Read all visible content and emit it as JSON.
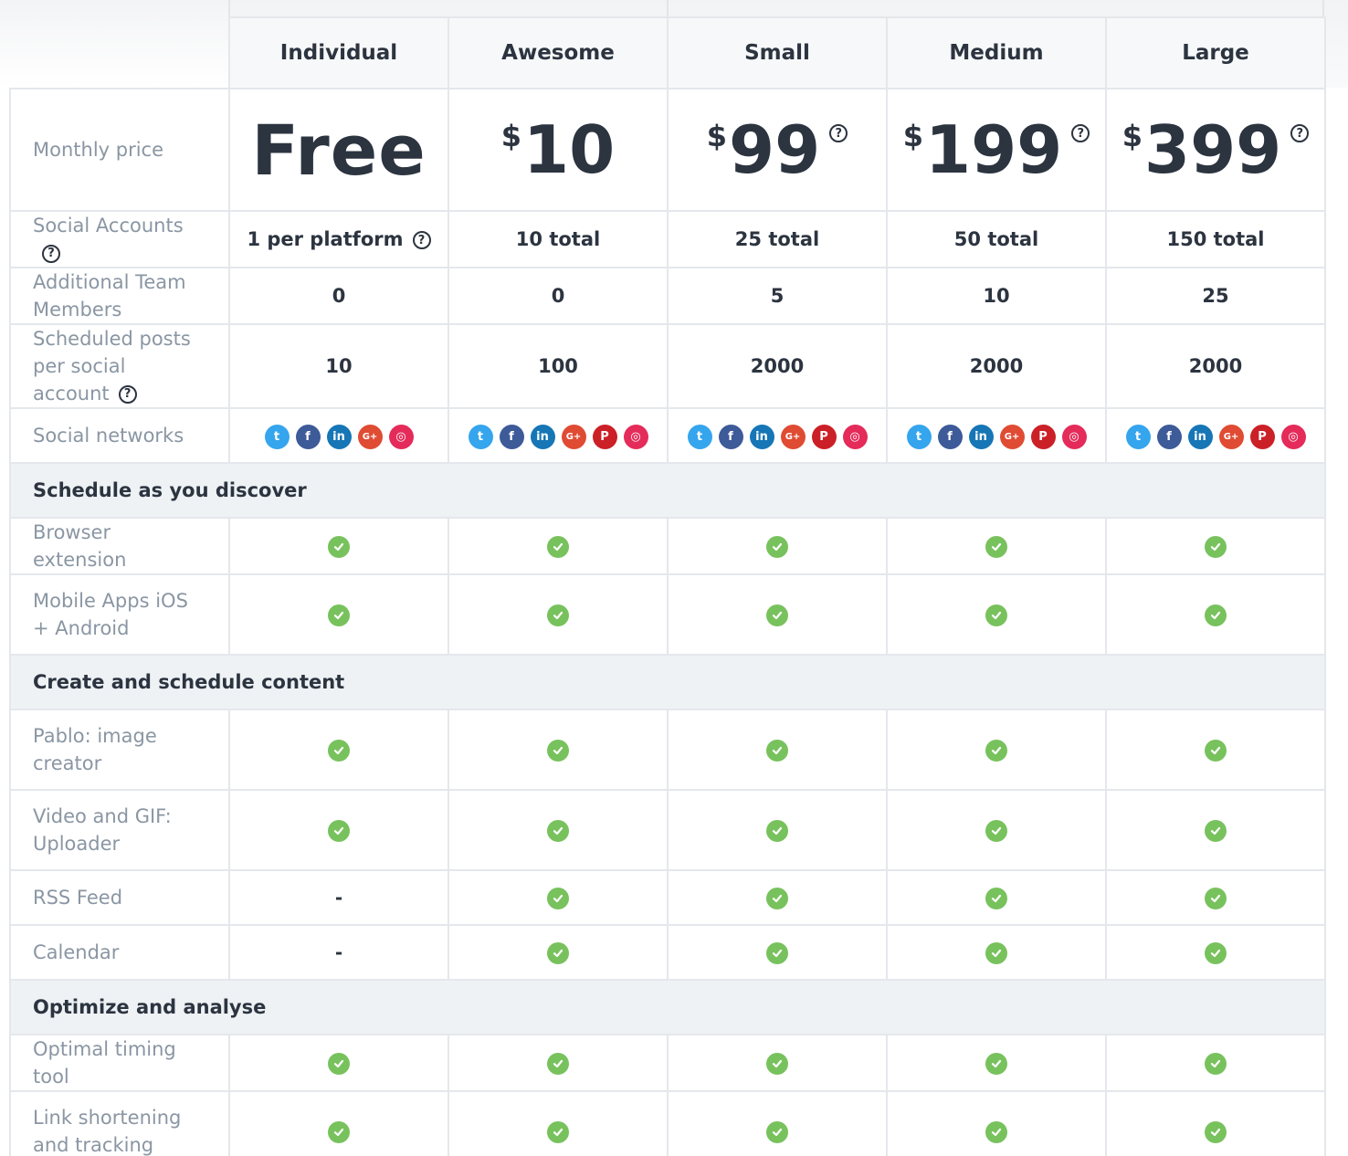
{
  "plans": [
    {
      "name": "Individual",
      "price": "Free",
      "currency": "",
      "has_help": false,
      "social_accounts": "1 per platform",
      "social_accounts_help": true,
      "team_members": "0",
      "scheduled_posts": "10",
      "networks": [
        "twitter",
        "facebook",
        "linkedin",
        "gplus",
        "instagram"
      ]
    },
    {
      "name": "Awesome",
      "price": "10",
      "currency": "$",
      "has_help": false,
      "social_accounts": "10 total",
      "social_accounts_help": false,
      "team_members": "0",
      "scheduled_posts": "100",
      "networks": [
        "twitter",
        "facebook",
        "linkedin",
        "gplus",
        "pinterest",
        "instagram"
      ]
    },
    {
      "name": "Small",
      "price": "99",
      "currency": "$",
      "has_help": true,
      "social_accounts": "25 total",
      "social_accounts_help": false,
      "team_members": "5",
      "scheduled_posts": "2000",
      "networks": [
        "twitter",
        "facebook",
        "linkedin",
        "gplus",
        "pinterest",
        "instagram"
      ]
    },
    {
      "name": "Medium",
      "price": "199",
      "currency": "$",
      "has_help": true,
      "social_accounts": "50 total",
      "social_accounts_help": false,
      "team_members": "10",
      "scheduled_posts": "2000",
      "networks": [
        "twitter",
        "facebook",
        "linkedin",
        "gplus",
        "pinterest",
        "instagram"
      ]
    },
    {
      "name": "Large",
      "price": "399",
      "currency": "$",
      "has_help": true,
      "social_accounts": "150 total",
      "social_accounts_help": false,
      "team_members": "25",
      "scheduled_posts": "2000",
      "networks": [
        "twitter",
        "facebook",
        "linkedin",
        "gplus",
        "pinterest",
        "instagram"
      ]
    }
  ],
  "rows": {
    "monthly_price": "Monthly price",
    "social_accounts": "Social Accounts",
    "team_members": "Additional Team Members",
    "scheduled_posts": "Scheduled posts per social account",
    "social_networks": "Social networks"
  },
  "help_glyph": "?",
  "dash_glyph": "-",
  "sections": [
    {
      "title": "Schedule as you discover",
      "features": [
        {
          "label": "Browser extension",
          "values": [
            true,
            true,
            true,
            true,
            true
          ],
          "tall": false
        },
        {
          "label": "Mobile Apps iOS + Android",
          "values": [
            true,
            true,
            true,
            true,
            true
          ],
          "tall": true
        }
      ]
    },
    {
      "title": "Create and schedule content",
      "features": [
        {
          "label": "Pablo: image creator",
          "values": [
            true,
            true,
            true,
            true,
            true
          ],
          "tall": true
        },
        {
          "label": "Video and GIF: Uploader",
          "values": [
            true,
            true,
            true,
            true,
            true
          ],
          "tall": true
        },
        {
          "label": "RSS Feed",
          "values": [
            false,
            true,
            true,
            true,
            true
          ],
          "tall": false
        },
        {
          "label": "Calendar",
          "values": [
            false,
            true,
            true,
            true,
            true
          ],
          "tall": false
        }
      ]
    },
    {
      "title": "Optimize and analyse",
      "features": [
        {
          "label": "Optimal timing tool",
          "values": [
            true,
            true,
            true,
            true,
            true
          ],
          "tall": false
        },
        {
          "label": "Link shortening and tracking",
          "values": [
            true,
            true,
            true,
            true,
            true
          ],
          "tall": true
        }
      ]
    }
  ],
  "network_glyphs": {
    "twitter": "t",
    "facebook": "f",
    "linkedin": "in",
    "gplus": "G+",
    "pinterest": "P",
    "instagram": "◎"
  },
  "colors": {
    "check": "#78c25d",
    "section_bg": "#eef2f5",
    "label": "#8a96a3",
    "text": "#2c3440"
  }
}
